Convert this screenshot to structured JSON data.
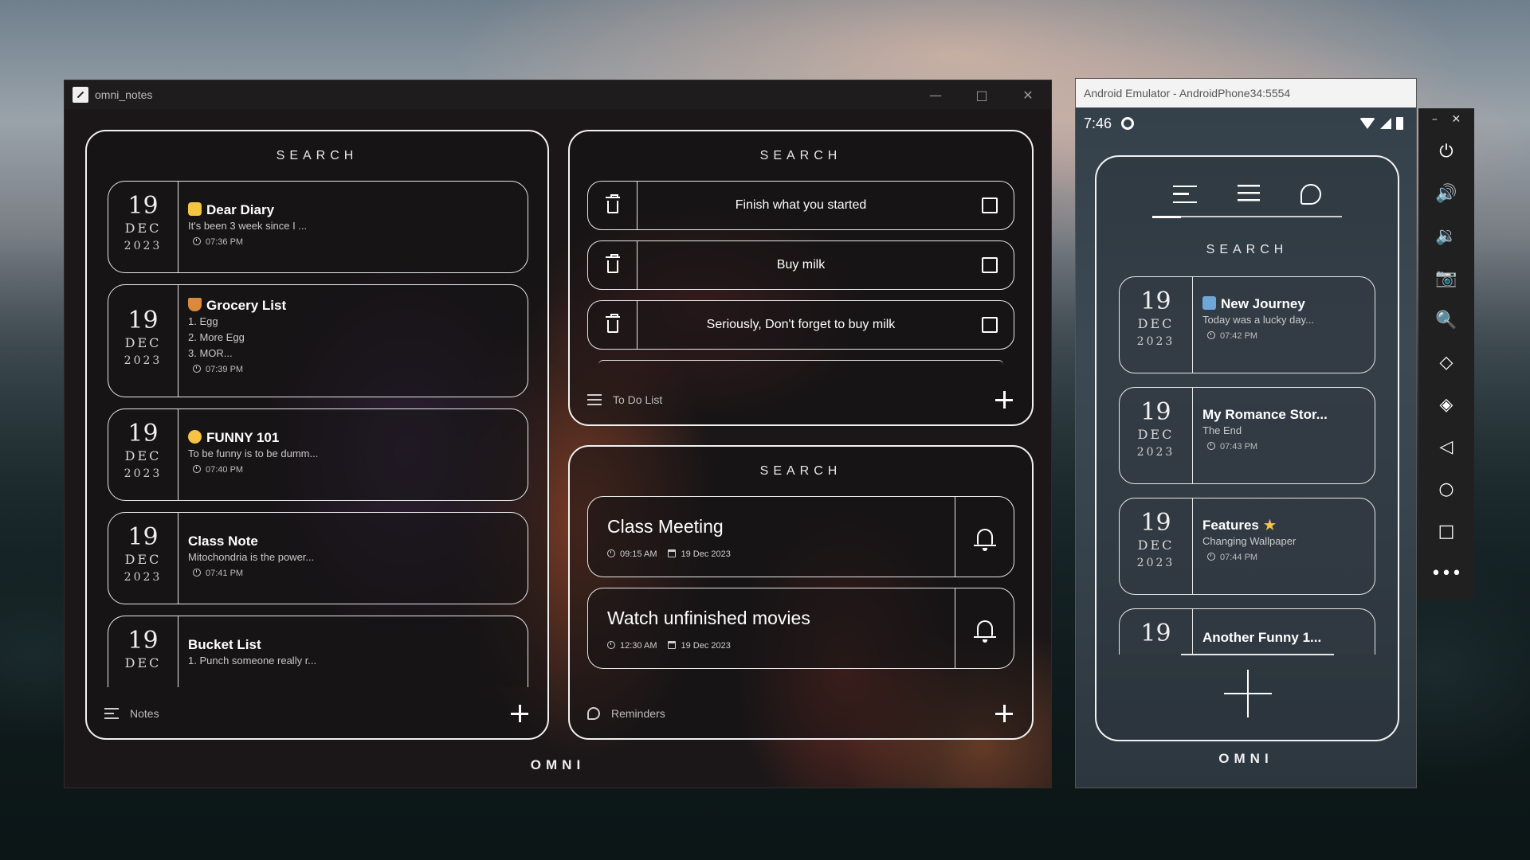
{
  "desktop_window": {
    "title": "omni_notes",
    "controls": {
      "minimize": "—",
      "maximize": "□",
      "close": "✕"
    },
    "notes_panel": {
      "search_label": "SEARCH",
      "footer_label": "Notes",
      "notes": [
        {
          "day": "19",
          "month": "DEC",
          "year": "2023",
          "emoji": "notepad",
          "title": "Dear Diary",
          "body": [
            "It's been 3 week since I ..."
          ],
          "time": "07:36 PM"
        },
        {
          "day": "19",
          "month": "DEC",
          "year": "2023",
          "emoji": "basket",
          "title": "Grocery List",
          "body": [
            "1. Egg",
            "2. More Egg",
            "3. MOR..."
          ],
          "time": "07:39 PM"
        },
        {
          "day": "19",
          "month": "DEC",
          "year": "2023",
          "emoji": "grin",
          "title": "FUNNY 101",
          "body": [
            "To be funny is to be dumm..."
          ],
          "time": "07:40 PM"
        },
        {
          "day": "19",
          "month": "DEC",
          "year": "2023",
          "emoji": "",
          "title": "Class Note",
          "body": [
            "Mitochondria is the power..."
          ],
          "time": "07:41 PM"
        },
        {
          "day": "19",
          "month": "DEC",
          "year": "",
          "emoji": "",
          "title": "Bucket List",
          "body": [
            "1. Punch someone really r..."
          ],
          "time": ""
        }
      ]
    },
    "todo_panel": {
      "search_label": "SEARCH",
      "footer_label": "To Do List",
      "items": [
        {
          "text": "Finish what you started",
          "checked": false
        },
        {
          "text": "Buy milk",
          "checked": false
        },
        {
          "text": "Seriously, Don't forget to buy milk",
          "checked": false
        }
      ]
    },
    "reminders_panel": {
      "search_label": "SEARCH",
      "footer_label": "Reminders",
      "items": [
        {
          "title": "Class Meeting",
          "time": "09:15 AM",
          "date": "19 Dec 2023"
        },
        {
          "title": "Watch unfinished movies",
          "time": "12:30 AM",
          "date": "19 Dec 2023"
        }
      ]
    },
    "brand": "OMNI"
  },
  "emulator": {
    "title": "Android Emulator - AndroidPhone34:5554",
    "status_time": "7:46",
    "search_label": "SEARCH",
    "brand": "OMNI",
    "notes": [
      {
        "day": "19",
        "month": "DEC",
        "year": "2023",
        "emoji": "bus",
        "title": "New Journey",
        "body": "Today was a lucky day...",
        "time": "07:42 PM"
      },
      {
        "day": "19",
        "month": "DEC",
        "year": "2023",
        "emoji": "",
        "title": "My Romance Stor...",
        "body": "The End",
        "time": "07:43 PM"
      },
      {
        "day": "19",
        "month": "DEC",
        "year": "2023",
        "emoji": "star",
        "title": "Features",
        "body": "Changing Wallpaper",
        "time": "07:44 PM"
      },
      {
        "day": "19",
        "month": "",
        "year": "",
        "emoji": "",
        "title": "Another Funny 1...",
        "body": "",
        "time": ""
      }
    ],
    "side_controls": {
      "minimize": "–",
      "close": "✕",
      "more": "•••"
    }
  },
  "colors": {
    "accent": "#ffffff",
    "panel_border": "#f2f2f2",
    "emoji_notepad": "#f5c542",
    "emoji_basket": "#d98a3a",
    "emoji_grin": "#f6c343",
    "star": "#f6c343"
  }
}
